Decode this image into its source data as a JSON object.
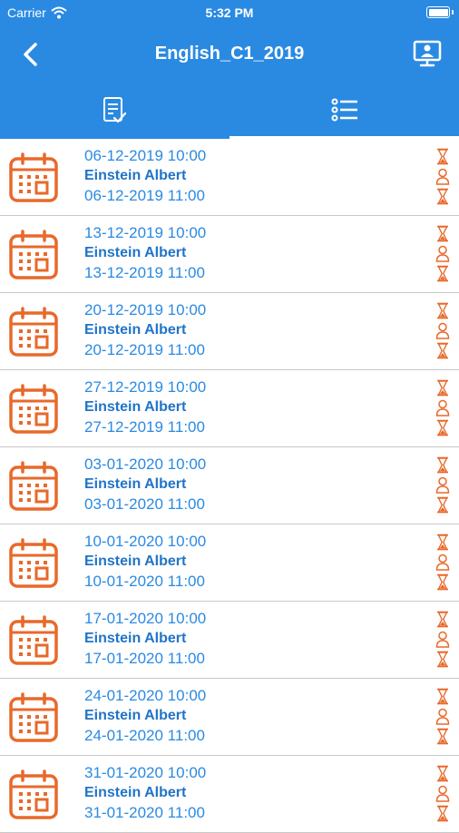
{
  "status_bar": {
    "carrier": "Carrier",
    "time": "5:32 PM"
  },
  "header": {
    "title": "English_C1_2019",
    "back_icon": "chevron-left-icon",
    "action_icon": "classroom-monitor-icon"
  },
  "tabs": [
    {
      "icon": "clipboard-check-icon",
      "selected": false
    },
    {
      "icon": "list-icon",
      "selected": true
    }
  ],
  "colors": {
    "primary": "#2a8ae2",
    "accent_orange": "#e8692a",
    "divider": "#c8c8c8"
  },
  "sessions": [
    {
      "start": "06-12-2019 10:00",
      "teacher": "Einstein Albert",
      "end": "06-12-2019 11:00"
    },
    {
      "start": "13-12-2019 10:00",
      "teacher": "Einstein Albert",
      "end": "13-12-2019 11:00"
    },
    {
      "start": "20-12-2019 10:00",
      "teacher": "Einstein Albert",
      "end": "20-12-2019 11:00"
    },
    {
      "start": "27-12-2019 10:00",
      "teacher": "Einstein Albert",
      "end": "27-12-2019 11:00"
    },
    {
      "start": "03-01-2020 10:00",
      "teacher": "Einstein Albert",
      "end": "03-01-2020 11:00"
    },
    {
      "start": "10-01-2020 10:00",
      "teacher": "Einstein Albert",
      "end": "10-01-2020 11:00"
    },
    {
      "start": "17-01-2020 10:00",
      "teacher": "Einstein Albert",
      "end": "17-01-2020 11:00"
    },
    {
      "start": "24-01-2020 10:00",
      "teacher": "Einstein Albert",
      "end": "24-01-2020 11:00"
    },
    {
      "start": "31-01-2020 10:00",
      "teacher": "Einstein Albert",
      "end": "31-01-2020 11:00"
    }
  ]
}
